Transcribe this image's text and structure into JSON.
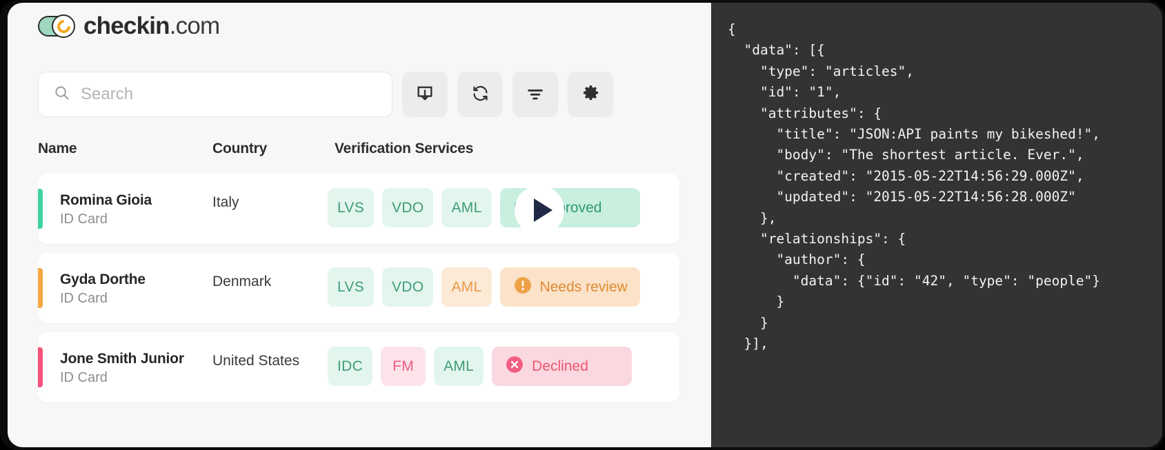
{
  "brand": {
    "name_bold": "checkin",
    "name_light": ".com",
    "logo_icon": "toggle-c-logo"
  },
  "search": {
    "placeholder": "Search",
    "value": "",
    "icon": "search-icon"
  },
  "toolbar": {
    "buttons": [
      {
        "name": "download-button",
        "icon": "download-tray-icon"
      },
      {
        "name": "refresh-button",
        "icon": "refresh-sync-icon"
      },
      {
        "name": "filter-button",
        "icon": "filter-lines-icon"
      },
      {
        "name": "settings-button",
        "icon": "gear-icon"
      }
    ]
  },
  "table": {
    "headers": {
      "name": "Name",
      "country": "Country",
      "services": "Verification Services"
    },
    "rows": [
      {
        "accent": "#3fd3a0",
        "name": "Romina Gioia",
        "document": "ID Card",
        "country": "Italy",
        "services": [
          {
            "label": "LVS",
            "tone": "green"
          },
          {
            "label": "VDO",
            "tone": "green"
          },
          {
            "label": "AML",
            "tone": "green"
          }
        ],
        "status": {
          "label": "Approved",
          "tone": "approved",
          "icon": "check-circle-icon"
        }
      },
      {
        "accent": "#f5a742",
        "name": "Gyda Dorthe",
        "document": "ID Card",
        "country": "Denmark",
        "services": [
          {
            "label": "LVS",
            "tone": "green"
          },
          {
            "label": "VDO",
            "tone": "green"
          },
          {
            "label": "AML",
            "tone": "orange"
          }
        ],
        "status": {
          "label": "Needs review",
          "tone": "review",
          "icon": "exclamation-circle-icon"
        }
      },
      {
        "accent": "#f4537a",
        "name": "Jone Smith Junior",
        "document": "ID Card",
        "country": "United States",
        "services": [
          {
            "label": "IDC",
            "tone": "green"
          },
          {
            "label": "FM",
            "tone": "pink"
          },
          {
            "label": "AML",
            "tone": "green"
          }
        ],
        "status": {
          "label": "Declined",
          "tone": "declined",
          "icon": "x-circle-icon"
        }
      }
    ]
  },
  "video": {
    "play_button_icon": "play-icon"
  },
  "code": {
    "language": "json",
    "text": "{\n  \"data\": [{\n    \"type\": \"articles\",\n    \"id\": \"1\",\n    \"attributes\": {\n      \"title\": \"JSON:API paints my bikeshed!\",\n      \"body\": \"The shortest article. Ever.\",\n      \"created\": \"2015-05-22T14:56:29.000Z\",\n      \"updated\": \"2015-05-22T14:56:28.000Z\"\n    },\n    \"relationships\": {\n      \"author\": {\n        \"data\": {\"id\": \"42\", \"type\": \"people\"}\n      }\n    }\n  }],"
  },
  "colors": {
    "app_background": "#f7f7f7",
    "code_background": "#333333",
    "page_background": "#0c0c0c",
    "green": "#3f9a79",
    "orange": "#e08a33",
    "pink": "#ec5672",
    "play_triangle": "#202945"
  }
}
